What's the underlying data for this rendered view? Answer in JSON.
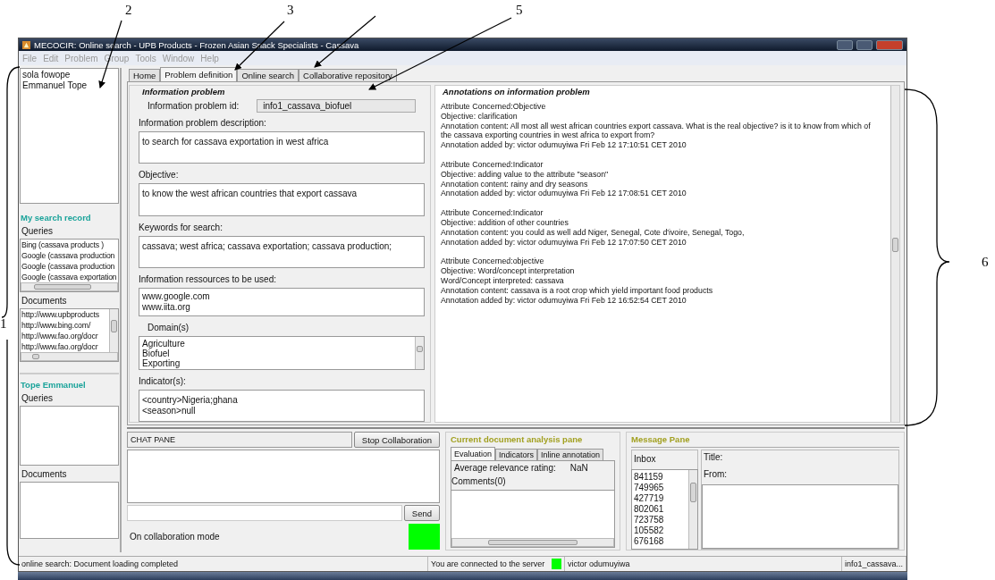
{
  "callouts": [
    {
      "kind": "arrow",
      "label": "2"
    },
    {
      "kind": "arrow",
      "label": "3"
    },
    {
      "kind": "arrow"
    },
    {
      "kind": "arrow",
      "label": "5"
    },
    {
      "kind": "brace",
      "label": "6"
    },
    {
      "kind": "brace",
      "label": "1"
    }
  ],
  "window": {
    "title": "MECOCIR: Online search - UPB Products - Frozen Asian Snack Specialists - Cassava"
  },
  "menu": [
    "File",
    "Edit",
    "Problem",
    "Group",
    "Tools",
    "Window",
    "Help"
  ],
  "users": [
    "sola fowope",
    "Emmanuel Tope"
  ],
  "search_record": {
    "title": "My search record",
    "queries_label": "Queries",
    "queries": [
      "Bing (cassava products )",
      "Google (cassava production",
      "Google (cassava production",
      "Google (cassava exportation"
    ],
    "documents_label": "Documents",
    "documents": [
      "http://www.upbproducts",
      "http://www.bing.com/",
      "http://www.fao.org/docr",
      "http://www.fao.org/docr"
    ]
  },
  "member_record": {
    "title": "Tope Emmanuel",
    "queries_label": "Queries",
    "documents_label": "Documents"
  },
  "tabs": [
    {
      "label": "Home",
      "selected": false
    },
    {
      "label": "Problem definition",
      "selected": true
    },
    {
      "label": "Online search",
      "selected": false
    },
    {
      "label": "Collaborative repository",
      "selected": false
    }
  ],
  "info_problem": {
    "title": "Information problem",
    "id_label": "Information problem id:",
    "id_value": "info1_cassava_biofuel",
    "fields": [
      {
        "kind": "text",
        "label": "Information problem description:",
        "lines": [
          "to search for cassava exportation in west africa"
        ]
      },
      {
        "kind": "text",
        "label": "Objective:",
        "lines": [
          "to know the west african countries that export cassava"
        ]
      },
      {
        "kind": "text",
        "label": "Keywords for search:",
        "lines": [
          "cassava; west africa; cassava exportation; cassava production;"
        ]
      },
      {
        "kind": "text",
        "label": "Information ressources to be used:",
        "lines": [
          "www.google.com",
          "www.iita.org"
        ]
      },
      {
        "kind": "list",
        "label": "Domain(s)",
        "lines": [
          "Agriculture",
          "Biofuel",
          "Exporting"
        ]
      },
      {
        "kind": "text",
        "label": "Indicator(s):",
        "lines": [
          "<country>Nigeria;ghana",
          "<season>null"
        ]
      }
    ]
  },
  "annotations": {
    "title": "Annotations on information problem",
    "entries": [
      [
        "Attribute Concerned:Objective",
        "Objective: clarification",
        "Annotation content: All most all west african countries export cassava. What is the real objective? is it to know from which of the cassava exporting countries in west africa to export from?",
        "Annotation added by: victor odumuyiwa  Fri Feb 12 17:10:51 CET 2010"
      ],
      [
        "Attribute Concerned:Indicator",
        "Objective: adding value to the attribute \"season\"",
        "Annotation content: rainy and dry seasons",
        "Annotation added by: victor odumuyiwa  Fri Feb 12 17:08:51 CET 2010"
      ],
      [
        "Attribute Concerned:Indicator",
        "Objective: addition of other countries",
        "Annotation content: you could as well add Niger, Senegal, Cote d'ivoire, Senegal, Togo,",
        "Annotation added by: victor odumuyiwa  Fri Feb 12 17:07:50 CET 2010"
      ],
      [
        "Attribute Concerned:objective",
        "Objective: Word/concept interpretation",
        "Word/Concept interpreted: cassava",
        "Annotation content: cassava is a root crop which yield important food products",
        "Annotation added by: victor odumuyiwa  Fri Feb 12 16:52:54 CET 2010"
      ]
    ]
  },
  "chat": {
    "title": "CHAT PANE",
    "stop_button": "Stop Collaboration",
    "send_button": "Send",
    "mode_label": "On collaboration mode",
    "mode_on": true
  },
  "analysis": {
    "title": "Current document analysis pane",
    "tabs": [
      {
        "label": "Evaluation",
        "selected": true
      },
      {
        "label": "Indicators",
        "selected": false
      },
      {
        "label": "Inline annotation",
        "selected": false
      }
    ],
    "rating_label": "Average relevance rating:",
    "rating_value": "NaN",
    "comments_label": "Comments(0)"
  },
  "messages": {
    "title": "Message Pane",
    "inbox_label": "Inbox",
    "inbox": [
      "841159",
      "749965",
      "427719",
      "802061",
      "723758",
      "105582",
      "676168"
    ],
    "title_label": "Title:",
    "from_label": "From:"
  },
  "status_bar": {
    "message": "online search: Document loading completed",
    "connection": "You are connected to the server",
    "connected": true,
    "user": "victor odumuyiwa",
    "problem": "info1_cassava..."
  }
}
